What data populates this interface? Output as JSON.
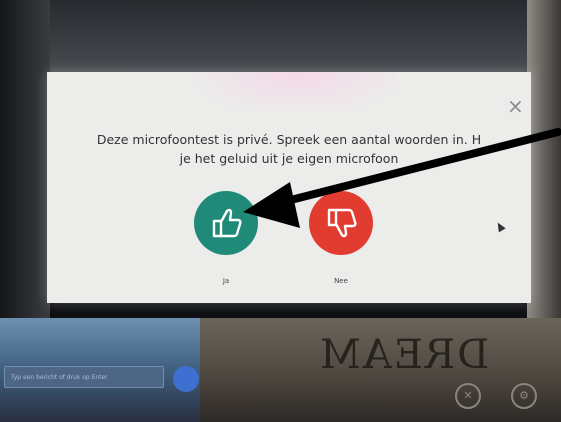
{
  "dialog": {
    "message_line1": "Deze microfoontest is privé. Spreek een aantal woorden in. H",
    "message_line2": "je het geluid uit je eigen microfoon",
    "close_label": "×",
    "yes_label": "Ja",
    "no_label": "Nee",
    "yes_icon": "thumbs-up-icon",
    "no_icon": "thumbs-down-icon",
    "colors": {
      "yes": "#1f8a78",
      "no": "#e23b30",
      "dialog_bg": "#ececea"
    }
  },
  "background": {
    "chat_placeholder": "Typ een bericht of druk op Enter",
    "video_text": "DREAM"
  }
}
